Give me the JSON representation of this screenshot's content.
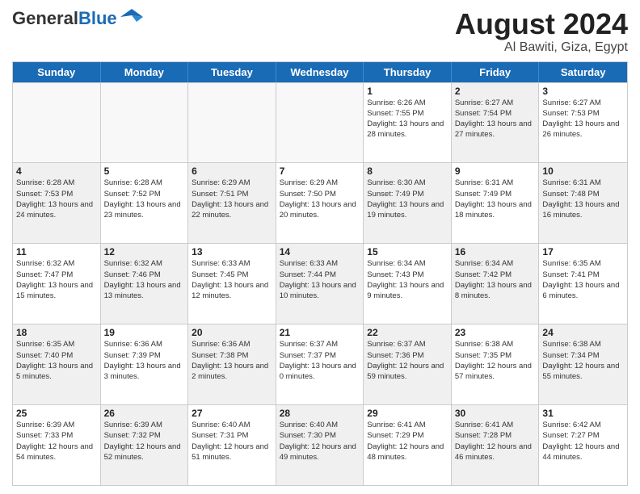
{
  "header": {
    "logo_general": "General",
    "logo_blue": "Blue",
    "month_title": "August 2024",
    "location": "Al Bawiti, Giza, Egypt"
  },
  "weekdays": [
    "Sunday",
    "Monday",
    "Tuesday",
    "Wednesday",
    "Thursday",
    "Friday",
    "Saturday"
  ],
  "rows": [
    [
      {
        "day": "",
        "info": "",
        "empty": true
      },
      {
        "day": "",
        "info": "",
        "empty": true
      },
      {
        "day": "",
        "info": "",
        "empty": true
      },
      {
        "day": "",
        "info": "",
        "empty": true
      },
      {
        "day": "1",
        "info": "Sunrise: 6:26 AM\nSunset: 7:55 PM\nDaylight: 13 hours and 28 minutes.",
        "shaded": false
      },
      {
        "day": "2",
        "info": "Sunrise: 6:27 AM\nSunset: 7:54 PM\nDaylight: 13 hours and 27 minutes.",
        "shaded": true
      },
      {
        "day": "3",
        "info": "Sunrise: 6:27 AM\nSunset: 7:53 PM\nDaylight: 13 hours and 26 minutes.",
        "shaded": false
      }
    ],
    [
      {
        "day": "4",
        "info": "Sunrise: 6:28 AM\nSunset: 7:53 PM\nDaylight: 13 hours and 24 minutes.",
        "shaded": true
      },
      {
        "day": "5",
        "info": "Sunrise: 6:28 AM\nSunset: 7:52 PM\nDaylight: 13 hours and 23 minutes.",
        "shaded": false
      },
      {
        "day": "6",
        "info": "Sunrise: 6:29 AM\nSunset: 7:51 PM\nDaylight: 13 hours and 22 minutes.",
        "shaded": true
      },
      {
        "day": "7",
        "info": "Sunrise: 6:29 AM\nSunset: 7:50 PM\nDaylight: 13 hours and 20 minutes.",
        "shaded": false
      },
      {
        "day": "8",
        "info": "Sunrise: 6:30 AM\nSunset: 7:49 PM\nDaylight: 13 hours and 19 minutes.",
        "shaded": true
      },
      {
        "day": "9",
        "info": "Sunrise: 6:31 AM\nSunset: 7:49 PM\nDaylight: 13 hours and 18 minutes.",
        "shaded": false
      },
      {
        "day": "10",
        "info": "Sunrise: 6:31 AM\nSunset: 7:48 PM\nDaylight: 13 hours and 16 minutes.",
        "shaded": true
      }
    ],
    [
      {
        "day": "11",
        "info": "Sunrise: 6:32 AM\nSunset: 7:47 PM\nDaylight: 13 hours and 15 minutes.",
        "shaded": false
      },
      {
        "day": "12",
        "info": "Sunrise: 6:32 AM\nSunset: 7:46 PM\nDaylight: 13 hours and 13 minutes.",
        "shaded": true
      },
      {
        "day": "13",
        "info": "Sunrise: 6:33 AM\nSunset: 7:45 PM\nDaylight: 13 hours and 12 minutes.",
        "shaded": false
      },
      {
        "day": "14",
        "info": "Sunrise: 6:33 AM\nSunset: 7:44 PM\nDaylight: 13 hours and 10 minutes.",
        "shaded": true
      },
      {
        "day": "15",
        "info": "Sunrise: 6:34 AM\nSunset: 7:43 PM\nDaylight: 13 hours and 9 minutes.",
        "shaded": false
      },
      {
        "day": "16",
        "info": "Sunrise: 6:34 AM\nSunset: 7:42 PM\nDaylight: 13 hours and 8 minutes.",
        "shaded": true
      },
      {
        "day": "17",
        "info": "Sunrise: 6:35 AM\nSunset: 7:41 PM\nDaylight: 13 hours and 6 minutes.",
        "shaded": false
      }
    ],
    [
      {
        "day": "18",
        "info": "Sunrise: 6:35 AM\nSunset: 7:40 PM\nDaylight: 13 hours and 5 minutes.",
        "shaded": true
      },
      {
        "day": "19",
        "info": "Sunrise: 6:36 AM\nSunset: 7:39 PM\nDaylight: 13 hours and 3 minutes.",
        "shaded": false
      },
      {
        "day": "20",
        "info": "Sunrise: 6:36 AM\nSunset: 7:38 PM\nDaylight: 13 hours and 2 minutes.",
        "shaded": true
      },
      {
        "day": "21",
        "info": "Sunrise: 6:37 AM\nSunset: 7:37 PM\nDaylight: 13 hours and 0 minutes.",
        "shaded": false
      },
      {
        "day": "22",
        "info": "Sunrise: 6:37 AM\nSunset: 7:36 PM\nDaylight: 12 hours and 59 minutes.",
        "shaded": true
      },
      {
        "day": "23",
        "info": "Sunrise: 6:38 AM\nSunset: 7:35 PM\nDaylight: 12 hours and 57 minutes.",
        "shaded": false
      },
      {
        "day": "24",
        "info": "Sunrise: 6:38 AM\nSunset: 7:34 PM\nDaylight: 12 hours and 55 minutes.",
        "shaded": true
      }
    ],
    [
      {
        "day": "25",
        "info": "Sunrise: 6:39 AM\nSunset: 7:33 PM\nDaylight: 12 hours and 54 minutes.",
        "shaded": false
      },
      {
        "day": "26",
        "info": "Sunrise: 6:39 AM\nSunset: 7:32 PM\nDaylight: 12 hours and 52 minutes.",
        "shaded": true
      },
      {
        "day": "27",
        "info": "Sunrise: 6:40 AM\nSunset: 7:31 PM\nDaylight: 12 hours and 51 minutes.",
        "shaded": false
      },
      {
        "day": "28",
        "info": "Sunrise: 6:40 AM\nSunset: 7:30 PM\nDaylight: 12 hours and 49 minutes.",
        "shaded": true
      },
      {
        "day": "29",
        "info": "Sunrise: 6:41 AM\nSunset: 7:29 PM\nDaylight: 12 hours and 48 minutes.",
        "shaded": false
      },
      {
        "day": "30",
        "info": "Sunrise: 6:41 AM\nSunset: 7:28 PM\nDaylight: 12 hours and 46 minutes.",
        "shaded": true
      },
      {
        "day": "31",
        "info": "Sunrise: 6:42 AM\nSunset: 7:27 PM\nDaylight: 12 hours and 44 minutes.",
        "shaded": false
      }
    ]
  ]
}
